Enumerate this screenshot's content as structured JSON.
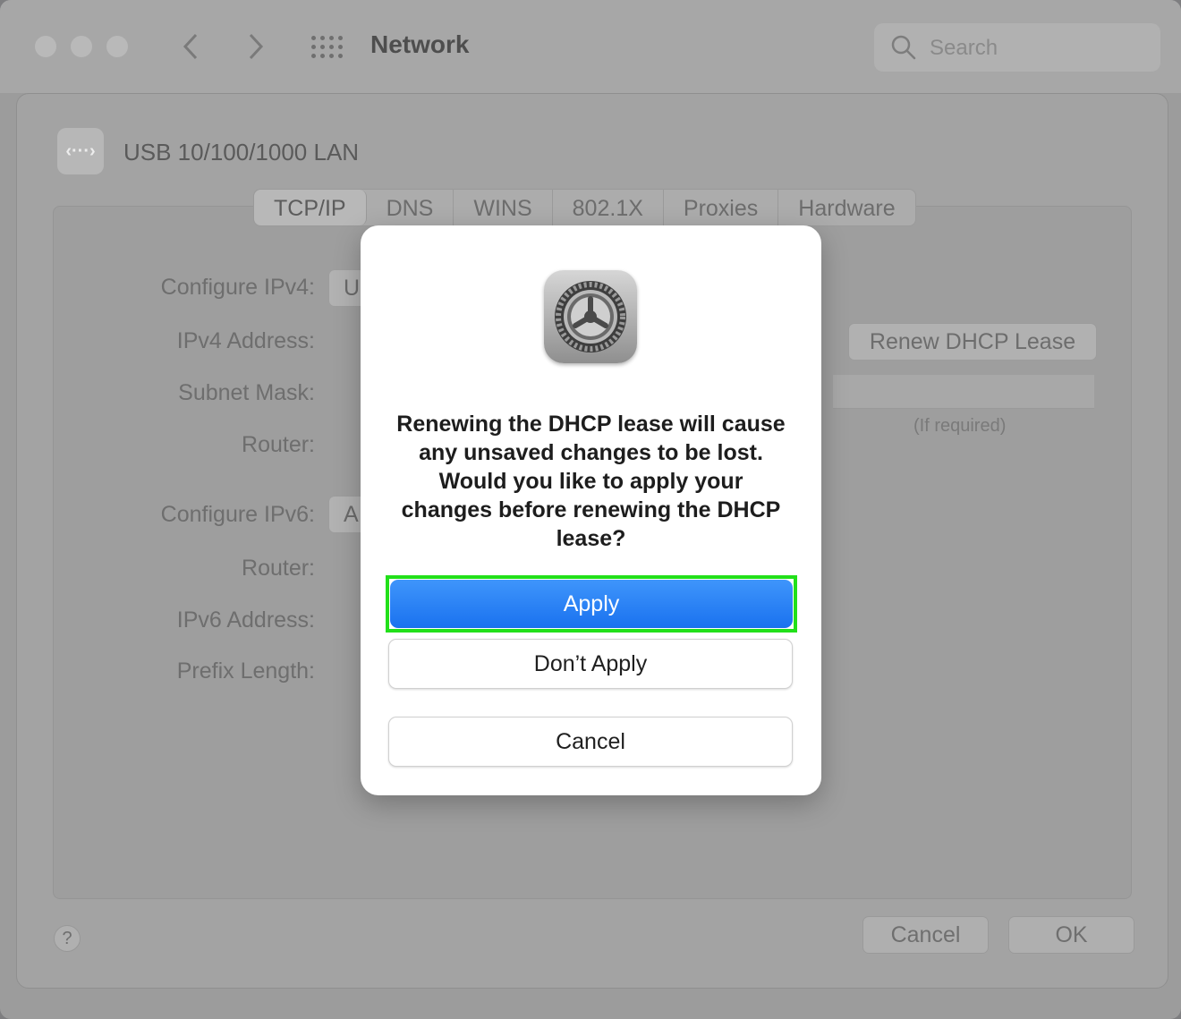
{
  "window": {
    "title": "Network",
    "search_placeholder": "Search"
  },
  "interface": {
    "name": "USB 10/100/1000 LAN"
  },
  "tabs": [
    {
      "label": "TCP/IP"
    },
    {
      "label": "DNS"
    },
    {
      "label": "WINS"
    },
    {
      "label": "802.1X"
    },
    {
      "label": "Proxies"
    },
    {
      "label": "Hardware"
    }
  ],
  "form": {
    "configure_ipv4_label": "Configure IPv4:",
    "configure_ipv4_value": "U",
    "ipv4_address_label": "IPv4 Address:",
    "subnet_mask_label": "Subnet Mask:",
    "router_label": "Router:",
    "configure_ipv6_label": "Configure IPv6:",
    "configure_ipv6_value": "A",
    "router6_label": "Router:",
    "ipv6_address_label": "IPv6 Address:",
    "prefix_length_label": "Prefix Length:",
    "renew_button": "Renew DHCP Lease",
    "if_required": "(If required)"
  },
  "footer": {
    "help": "?",
    "cancel": "Cancel",
    "ok": "OK"
  },
  "dialog": {
    "message": "Renewing the DHCP lease will cause any unsaved changes to be lost. Would you like to apply your changes before renewing the DHCP lease?",
    "apply": "Apply",
    "dont_apply": "Don’t Apply",
    "cancel": "Cancel",
    "icon": "system-preferences-gear-icon",
    "accent_color": "#1a72ef",
    "highlight_color": "#22e01a"
  }
}
